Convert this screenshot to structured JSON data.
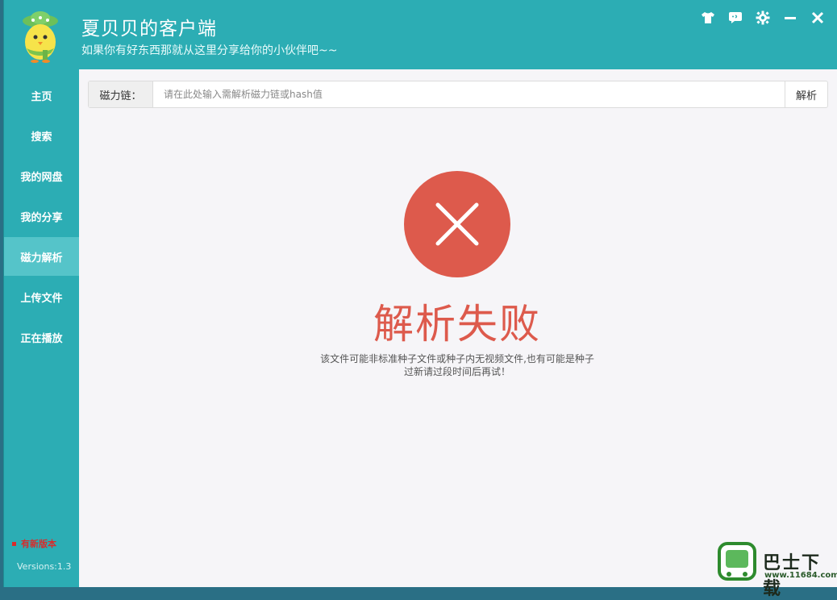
{
  "app": {
    "title": "夏贝贝的客户端",
    "subtitle": "如果你有好东西那就从这里分享给你的小伙伴吧~~"
  },
  "window_controls": [
    {
      "name": "skin-icon"
    },
    {
      "name": "feedback-icon"
    },
    {
      "name": "gear-icon"
    },
    {
      "name": "minimize-icon"
    },
    {
      "name": "close-icon"
    }
  ],
  "sidebar": {
    "items": [
      {
        "label": "主页"
      },
      {
        "label": "搜索"
      },
      {
        "label": "我的网盘"
      },
      {
        "label": "我的分享"
      },
      {
        "label": "磁力解析",
        "active": true
      },
      {
        "label": "上传文件"
      },
      {
        "label": "正在播放"
      }
    ],
    "new_version": "有新版本",
    "version": "Versions:1.3"
  },
  "magnet": {
    "label": "磁力链：",
    "placeholder": "请在此处输入需解析磁力链或hash值",
    "value": "",
    "button": "解析"
  },
  "result": {
    "title": "解析失败",
    "desc_line1": "该文件可能非标准种子文件或种子内无视频文件,也有可能是种子",
    "desc_line2": "过新请过段时间后再试！"
  },
  "watermark": {
    "text": "巴士下载",
    "url": "www.11684.com"
  },
  "colors": {
    "accent": "#2cadb4",
    "active_nav": "#55c4c9",
    "error": "#dd5a4c"
  }
}
